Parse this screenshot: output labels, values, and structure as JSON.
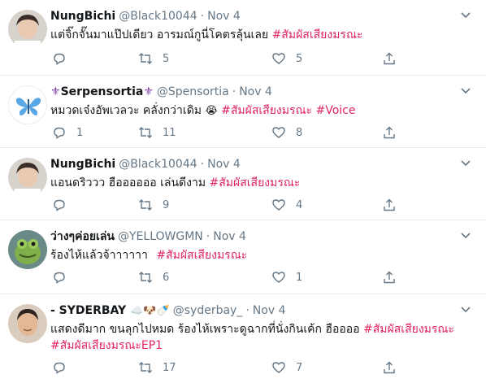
{
  "tweets": [
    {
      "name": "NungBichi",
      "handle": "@Black10044",
      "date": "Nov 4",
      "text": "แต่จิ๊กจั๊นมาแป๊ปเดียว อารมณ์กูนี่โคตรลุ้นเลย",
      "tags": [
        "#สัมผัสเสียงมรณะ"
      ],
      "replies": "",
      "retweets": "5",
      "likes": "5"
    },
    {
      "name_prefix": "⚜",
      "name": "Serpensortia",
      "name_suffix": "⚜",
      "handle": "@Spensortia",
      "date": "Nov 4",
      "text": "หมวดเจ๋งอัพเวลวะ คลั่งกว่าเดิม",
      "emoji": "😭",
      "tags": [
        "#สัมผัสเสียงมรณะ",
        "#Voice"
      ],
      "replies": "1",
      "retweets": "11",
      "likes": "8"
    },
    {
      "name": "NungBichi",
      "handle": "@Black10044",
      "date": "Nov 4",
      "text": "แอนดริววว ฮืออออออ เล่นดีงาม",
      "tags": [
        "#สัมผัสเสียงมรณะ"
      ],
      "replies": "",
      "retweets": "9",
      "likes": "4"
    },
    {
      "name": "ว่างๆค่อยเล่น",
      "handle": "@YELLOWGMN",
      "date": "Nov 4",
      "text": "ร้องไห้แล้วจ้าาาาาา",
      "tags": [
        "#สัมผัสเสียงมรณะ"
      ],
      "replies": "",
      "retweets": "6",
      "likes": "1"
    },
    {
      "name": "- SYDERBAY",
      "name_emoji": "☁️🐶🍼",
      "handle": "@syderbay_",
      "date": "Nov 4",
      "text": "แสดงดีมาก ขนลุกไปหมด ร้องไห้เพราะดูฉากที่นั่งกินเค้ก ฮืออออ",
      "tags": [
        "#สัมผัสเสียงมรณะ"
      ],
      "text_line2_tags": [
        "#สัมผัสเสียงมรณะEP1"
      ],
      "replies": "",
      "retweets": "17",
      "likes": "7"
    }
  ],
  "colors": {
    "hashtag": "#e0245e",
    "meta": "#657786",
    "text": "#14171a",
    "divider": "#e6ecf0"
  }
}
